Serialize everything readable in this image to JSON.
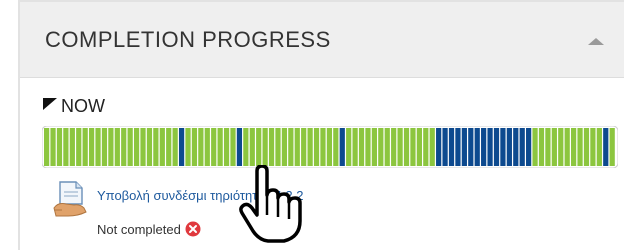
{
  "block": {
    "title": "COMPLETION PROGRESS",
    "collapse_icon": "chevron-up-icon"
  },
  "now": {
    "label": "NOW",
    "marker_icon": "triangle-marker-icon"
  },
  "progress": {
    "segments": [
      "g",
      "g",
      "g",
      "g",
      "g",
      "g",
      "g",
      "g",
      "g",
      "g",
      "g",
      "g",
      "g",
      "g",
      "g",
      "g",
      "g",
      "g",
      "g",
      "g",
      "g",
      "b",
      "g",
      "g",
      "g",
      "g",
      "g",
      "g",
      "g",
      "g",
      "b",
      "g",
      "g",
      "g",
      "g",
      "g",
      "g",
      "g",
      "g",
      "g",
      "g",
      "g",
      "g",
      "g",
      "g",
      "g",
      "b",
      "g",
      "g",
      "g",
      "g",
      "g",
      "g",
      "g",
      "g",
      "g",
      "g",
      "g",
      "g",
      "g",
      "g",
      "b",
      "b",
      "b",
      "b",
      "b",
      "b",
      "b",
      "b",
      "b",
      "b",
      "b",
      "b",
      "b",
      "b",
      "b",
      "g",
      "g",
      "g",
      "g",
      "g",
      "g",
      "g",
      "g",
      "g",
      "g",
      "g",
      "b",
      "g"
    ],
    "colors": {
      "g": "#8cc63f",
      "b": "#0d4a8f"
    }
  },
  "activity": {
    "name": "Υποβολή συνδέσμι     τηριότητας 4.2.2",
    "status": "Not completed",
    "icon": "assignment-icon",
    "status_icon": "not-completed-x-icon"
  },
  "cursor_icon": "hand-pointer-icon"
}
